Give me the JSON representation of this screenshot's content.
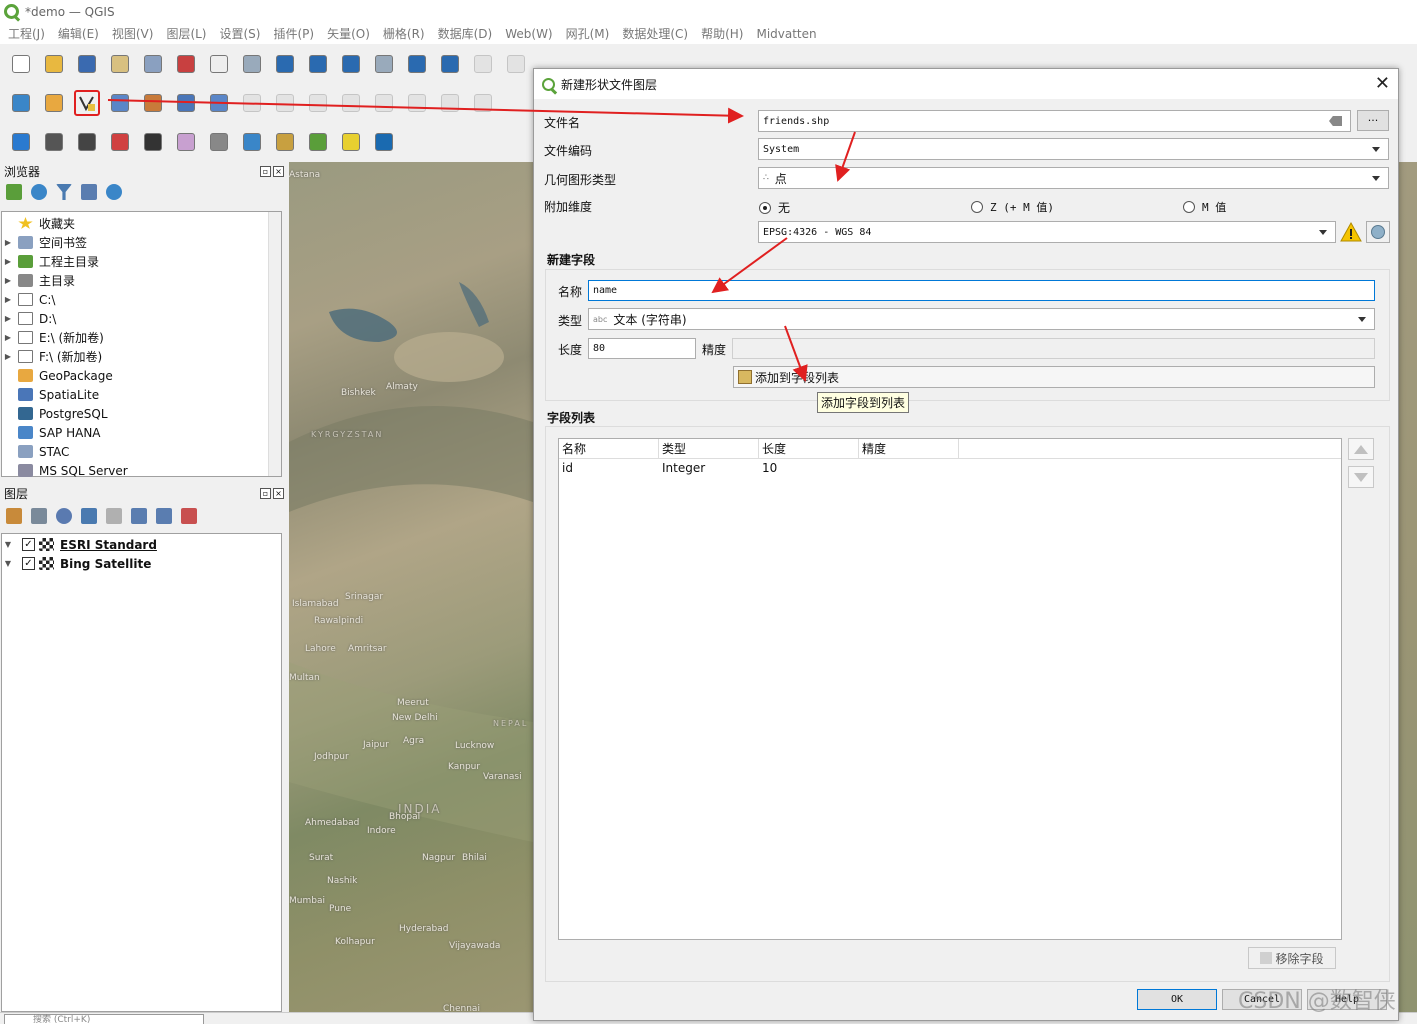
{
  "window": {
    "title": "*demo — QGIS"
  },
  "menu": [
    "工程(J)",
    "编辑(E)",
    "视图(V)",
    "图层(L)",
    "设置(S)",
    "插件(P)",
    "矢量(O)",
    "栅格(R)",
    "数据库(D)",
    "Web(W)",
    "网孔(M)",
    "数据处理(C)",
    "帮助(H)",
    "Midvatten"
  ],
  "browser_panel": {
    "title": "浏览器",
    "items": [
      {
        "label": "收藏夹",
        "icon": "star-icon"
      },
      {
        "label": "空间书签",
        "icon": "bookmark-icon"
      },
      {
        "label": "工程主目录",
        "icon": "project-home-icon"
      },
      {
        "label": "主目录",
        "icon": "home-icon"
      },
      {
        "label": "C:\\",
        "icon": "folder-icon"
      },
      {
        "label": "D:\\",
        "icon": "folder-icon"
      },
      {
        "label": "E:\\ (新加卷)",
        "icon": "folder-icon"
      },
      {
        "label": "F:\\ (新加卷)",
        "icon": "folder-icon"
      },
      {
        "label": "GeoPackage",
        "icon": "geopackage-icon"
      },
      {
        "label": "SpatiaLite",
        "icon": "spatialite-icon"
      },
      {
        "label": "PostgreSQL",
        "icon": "postgresql-icon"
      },
      {
        "label": "SAP HANA",
        "icon": "sap-hana-icon"
      },
      {
        "label": "STAC",
        "icon": "stac-icon"
      },
      {
        "label": "MS SQL Server",
        "icon": "mssql-icon"
      }
    ]
  },
  "layers_panel": {
    "title": "图层",
    "layers": [
      {
        "label": "ESRI Standard",
        "checked": true
      },
      {
        "label": "Bing Satellite",
        "checked": true
      }
    ]
  },
  "map_labels": [
    "Astana",
    "Almaty",
    "Bishkek",
    "KYRGYZSTAN",
    "Srinagar",
    "Islamabad",
    "Rawalpindi",
    "Lahore",
    "Amritsar",
    "Multan",
    "Meerut",
    "New Delhi",
    "NEPAL",
    "Jaipur",
    "Agra",
    "Lucknow",
    "Jodhpur",
    "Kanpur",
    "Varanasi",
    "INDIA",
    "Ahmedabad",
    "Bhopal",
    "Indore",
    "Surat",
    "Nagpur",
    "Bhilai",
    "Nashik",
    "Mumbai",
    "Pune",
    "Hyderabad",
    "Vijayawada",
    "Kolhapur",
    "Chennai"
  ],
  "locator": {
    "placeholder": "搜索 (Ctrl+K)"
  },
  "dialog": {
    "title": "新建形状文件图层",
    "file_name_label": "文件名",
    "file_name_value": "friends.shp",
    "browse_label": "···",
    "encoding_label": "文件编码",
    "encoding_value": "System",
    "geometry_label": "几何图形类型",
    "geometry_value": "点",
    "dims_label": "附加维度",
    "dim_options": [
      "无",
      "Z (+ M 值)",
      "M 值"
    ],
    "crs_value": "EPSG:4326 - WGS 84",
    "new_field_heading": "新建字段",
    "name_label": "名称",
    "name_value": "name",
    "type_label": "类型",
    "type_badge": "abc",
    "type_value": "文本 (字符串)",
    "length_label": "长度",
    "length_value": "80",
    "precision_label": "精度",
    "add_field_button": "添加到字段列表",
    "tooltip": "添加字段到列表",
    "field_list_heading": "字段列表",
    "columns": [
      "名称",
      "类型",
      "长度",
      "精度"
    ],
    "rows": [
      [
        "id",
        "Integer",
        "10",
        ""
      ]
    ],
    "remove_button": "移除字段",
    "ok": "OK",
    "cancel": "Cancel",
    "help": "Help"
  },
  "watermark": "CSDN @数智侠",
  "colors": {
    "accent_red": "#e02020",
    "focus_blue": "#0078d7",
    "qgis_green": "#5ba33b"
  }
}
